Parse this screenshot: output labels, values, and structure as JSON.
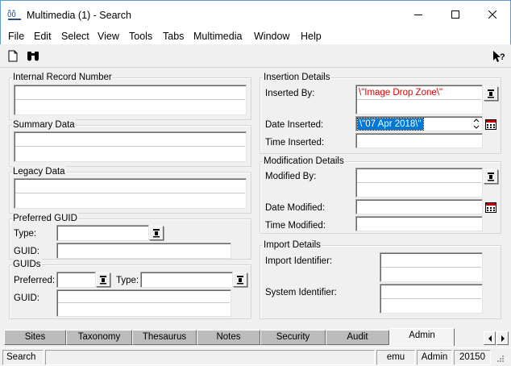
{
  "window": {
    "title": "Multimedia (1) - Search",
    "icon": "emu-app-icon"
  },
  "menu": [
    "File",
    "Edit",
    "Select",
    "View",
    "Tools",
    "Tabs",
    "Multimedia",
    "Window",
    "Help"
  ],
  "toolbar": {
    "icons": [
      "new-icon",
      "search-binoculars-icon",
      "whats-this-help-icon"
    ]
  },
  "left": {
    "internal_record": {
      "legend": "Internal Record Number"
    },
    "summary": {
      "legend": "Summary Data"
    },
    "legacy": {
      "legend": "Legacy Data"
    },
    "preferred_guid": {
      "legend": "Preferred GUID",
      "type_label": "Type:",
      "guid_label": "GUID:"
    },
    "guids": {
      "legend": "GUIDs",
      "preferred_label": "Preferred:",
      "type_label": "Type:",
      "guid_label": "GUID:"
    }
  },
  "right": {
    "insertion": {
      "legend": "Insertion Details",
      "inserted_by_label": "Inserted By:",
      "inserted_by_value": "\\\"Image Drop Zone\\\"",
      "date_label": "Date Inserted:",
      "date_value": "\\\"07 Apr 2018\\\"",
      "time_label": "Time Inserted:"
    },
    "modification": {
      "legend": "Modification Details",
      "by_label": "Modified By:",
      "date_label": "Date Modified:",
      "time_label": "Time Modified:"
    },
    "import": {
      "legend": "Import Details",
      "import_id_label": "Import Identifier:",
      "system_id_label": "System Identifier:"
    }
  },
  "tabs": [
    "Sites",
    "Taxonomy",
    "Thesaurus",
    "Notes",
    "Security",
    "Audit",
    "Admin"
  ],
  "active_tab": "Admin",
  "status": {
    "mode": "Search",
    "module": "emu",
    "user": "Admin",
    "count": "20150"
  },
  "colors": {
    "accent": "#0078d7",
    "required_text": "#e00000"
  }
}
